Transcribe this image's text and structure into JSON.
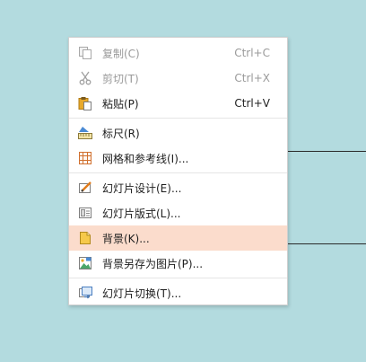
{
  "menu": {
    "items": [
      {
        "label": "复制(C)",
        "shortcut": "Ctrl+C",
        "icon": "copy-icon",
        "disabled": true
      },
      {
        "label": "剪切(T)",
        "shortcut": "Ctrl+X",
        "icon": "cut-icon",
        "disabled": true
      },
      {
        "label": "粘贴(P)",
        "shortcut": "Ctrl+V",
        "icon": "paste-icon",
        "disabled": false
      },
      {
        "label": "标尺(R)",
        "icon": "ruler-icon"
      },
      {
        "label": "网格和参考线(I)...",
        "icon": "grid-icon"
      },
      {
        "label": "幻灯片设计(E)...",
        "icon": "slide-design-icon"
      },
      {
        "label": "幻灯片版式(L)...",
        "icon": "slide-layout-icon"
      },
      {
        "label": "背景(K)...",
        "icon": "background-icon",
        "highlighted": true
      },
      {
        "label": "背景另存为图片(P)...",
        "icon": "save-background-image-icon"
      },
      {
        "label": "幻灯片切换(T)...",
        "icon": "slide-transition-icon"
      }
    ]
  },
  "colors": {
    "highlight": "#fbdccc",
    "canvas_background": "#b3dbdf",
    "disabled_text": "#9a9a9a"
  }
}
